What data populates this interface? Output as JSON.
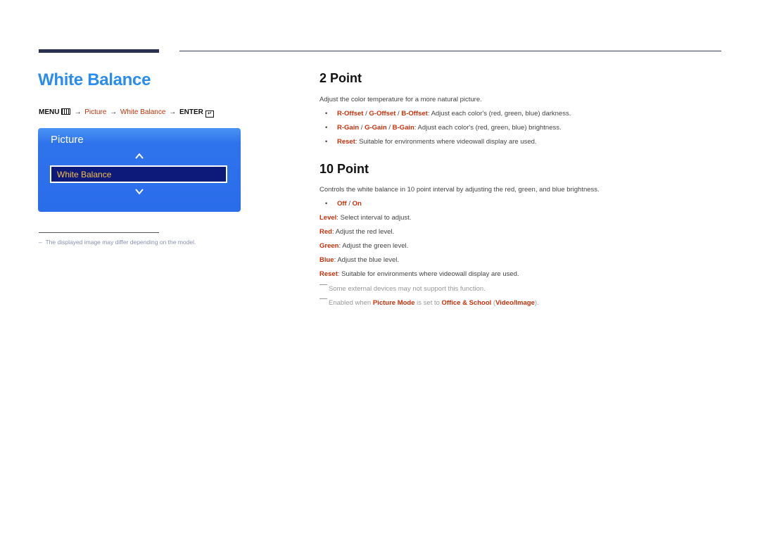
{
  "page": {
    "title": "White Balance",
    "menu_path": {
      "menu": "MENU",
      "arrow": "→",
      "step1": "Picture",
      "step2": "White Balance",
      "enter": "ENTER",
      "enter_glyph": "↵"
    },
    "osd": {
      "header": "Picture",
      "selected_item": "White Balance",
      "up_icon": "chevron-up",
      "down_icon": "chevron-down"
    },
    "footnote": "The displayed image may differ depending on the model.",
    "footnote_dash": "–"
  },
  "two_point": {
    "heading": "2 Point",
    "intro": "Adjust the color temperature for a more natural picture.",
    "bullet": "•",
    "items": [
      {
        "terms": [
          "R-Offset",
          "G-Offset",
          "B-Offset"
        ],
        "desc": ": Adjust each color's (red, green, blue) darkness."
      },
      {
        "terms": [
          "R-Gain",
          "G-Gain",
          "B-Gain"
        ],
        "desc": ": Adjust each color's (red, green, blue) brightness."
      },
      {
        "terms": [
          "Reset"
        ],
        "desc": ": Suitable for environments where videowall display are used."
      }
    ],
    "sep": " / "
  },
  "ten_point": {
    "heading": "10 Point",
    "intro": "Controls the white balance in 10 point interval by adjusting the red, green, and blue brightness.",
    "options": {
      "off": "Off",
      "on": "On"
    },
    "items": [
      {
        "term": "Level",
        "desc": ": Select interval to adjust."
      },
      {
        "term": "Red",
        "desc": ": Adjust the red level."
      },
      {
        "term": "Green",
        "desc": ": Adjust the green level."
      },
      {
        "term": "Blue",
        "desc": ": Adjust the blue level."
      },
      {
        "term": "Reset",
        "desc": ": Suitable for environments where videowall display are used."
      }
    ],
    "notes": {
      "note1": "Some external devices may not support this function.",
      "note2_a": "Enabled when ",
      "note2_term1": "Picture Mode",
      "note2_b": " is set to ",
      "note2_term2": "Office & School",
      "note2_c": " (",
      "note2_term3": "Video/Image",
      "note2_d": ")."
    }
  },
  "colors": {
    "title_blue": "#2a8cf0",
    "accent_red": "#c8310a",
    "panel_blue": "#2f73ec",
    "selected_bg": "#0d1a7a",
    "selected_text": "#f3c04a"
  }
}
